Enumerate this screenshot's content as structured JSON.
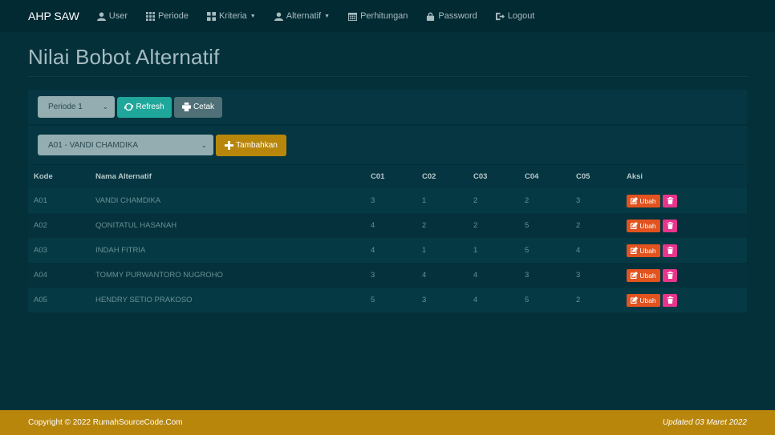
{
  "navbar": {
    "brand": "AHP SAW",
    "items": [
      {
        "label": "User",
        "icon": "user-icon"
      },
      {
        "label": "Periode",
        "icon": "grid-icon"
      },
      {
        "label": "Kriteria",
        "icon": "grid-large-icon",
        "dropdown": true
      },
      {
        "label": "Alternatif",
        "icon": "user-icon",
        "dropdown": true
      },
      {
        "label": "Perhitungan",
        "icon": "calendar-icon"
      },
      {
        "label": "Password",
        "icon": "lock-icon"
      },
      {
        "label": "Logout",
        "icon": "logout-icon"
      }
    ]
  },
  "page": {
    "title": "Nilai Bobot Alternatif"
  },
  "toolbar": {
    "periode_selected": "Periode 1",
    "refresh_label": "Refresh",
    "cetak_label": "Cetak"
  },
  "add_form": {
    "alternatif_selected": "A01 - VANDI CHAMDIKA",
    "tambah_label": "Tambahkan"
  },
  "table": {
    "headers": [
      "Kode",
      "Nama Alternatif",
      "C01",
      "C02",
      "C03",
      "C04",
      "C05",
      "Aksi"
    ],
    "rows": [
      {
        "kode": "A01",
        "nama": "VANDI CHAMDIKA",
        "c": [
          "3",
          "1",
          "2",
          "2",
          "3"
        ]
      },
      {
        "kode": "A02",
        "nama": "QONITATUL HASANAH",
        "c": [
          "4",
          "2",
          "2",
          "5",
          "2"
        ]
      },
      {
        "kode": "A03",
        "nama": "INDAH FITRIA",
        "c": [
          "4",
          "1",
          "1",
          "5",
          "4"
        ]
      },
      {
        "kode": "A04",
        "nama": "TOMMY PURWANTORO NUGROHO",
        "c": [
          "3",
          "4",
          "4",
          "3",
          "3"
        ]
      },
      {
        "kode": "A05",
        "nama": "HENDRY SETIO PRAKOSO",
        "c": [
          "5",
          "3",
          "4",
          "5",
          "2"
        ]
      }
    ],
    "ubah_label": "Ubah"
  },
  "footer": {
    "copyright": "Copyright © 2022 RumahSourceCode.Com",
    "updated": "Updated 03 Maret 2022"
  },
  "colors": {
    "background": "#04303a",
    "navbar": "#022a33",
    "refresh": "#1fa79b",
    "tambah": "#b8860b",
    "ubah": "#e2531f",
    "hapus": "#e8358b",
    "footer": "#b8860b"
  }
}
